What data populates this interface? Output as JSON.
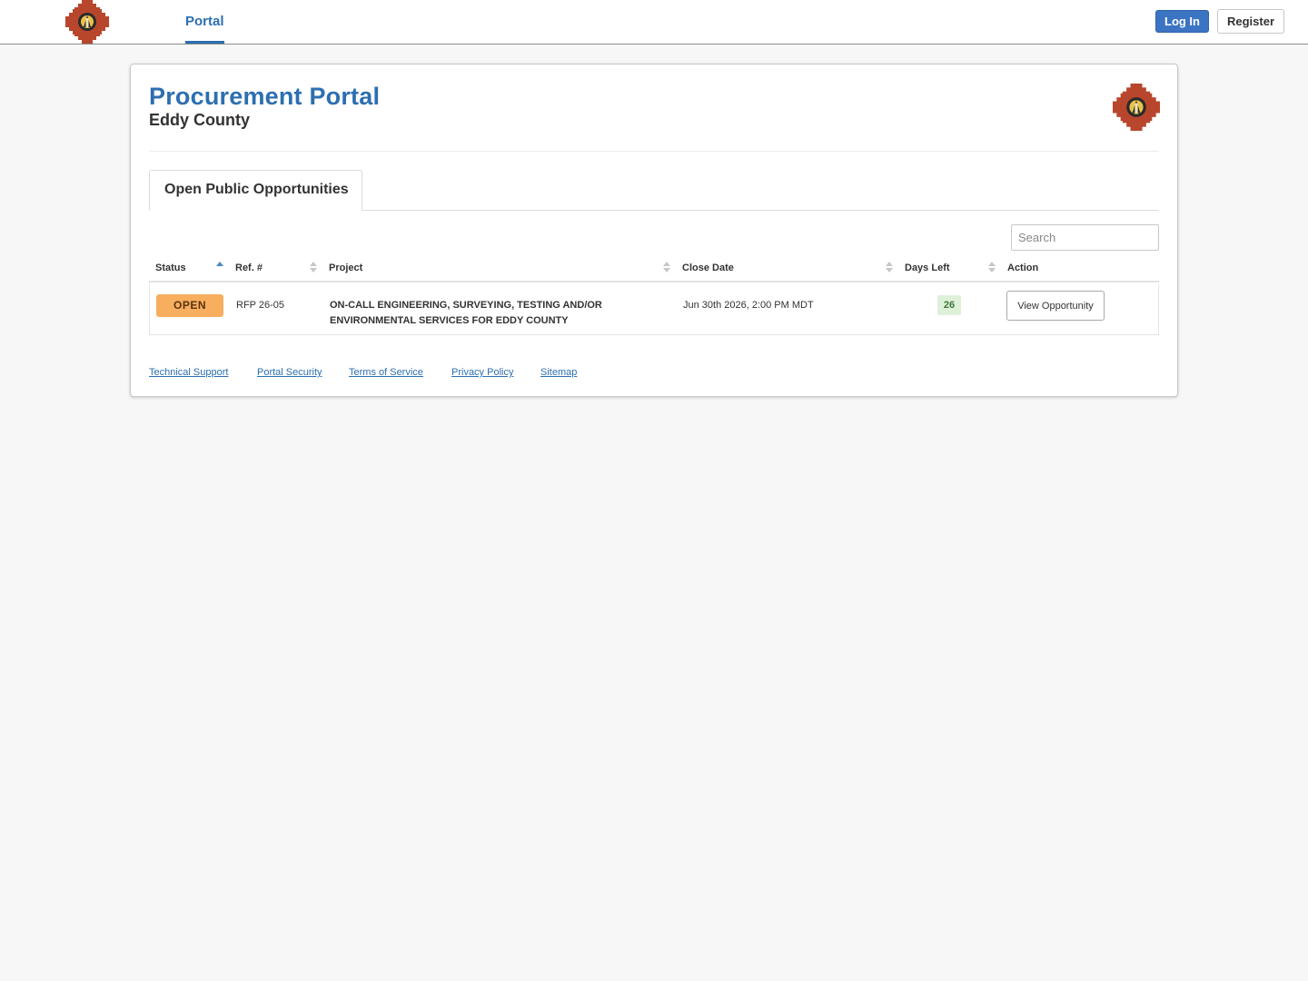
{
  "nav": {
    "logo_icon": "eddy-county-seal-icon",
    "tab_label": "Portal",
    "login_label": "Log In",
    "register_label": "Register"
  },
  "header": {
    "title": "Procurement Portal",
    "subtitle": "Eddy County"
  },
  "tabs": [
    {
      "label": "Open Public Opportunities",
      "active": true
    }
  ],
  "search": {
    "placeholder": "Search",
    "value": ""
  },
  "table": {
    "columns": [
      "Status",
      "Ref. #",
      "Project",
      "Close Date",
      "Days Left",
      "Action"
    ],
    "sort": {
      "column": "Status",
      "direction": "ascending"
    },
    "rows": [
      {
        "status": "OPEN",
        "ref": "RFP 26-05",
        "project_line1": "ON-CALL ENGINEERING, SURVEYING, TESTING AND/OR",
        "project_line2": "ENVIRONMENTAL SERVICES FOR EDDY COUNTY",
        "close_date": "Jun 30th 2026, 2:00 PM MDT",
        "days_left": "26",
        "action": "View Opportunity"
      }
    ]
  },
  "footer": {
    "links": [
      "Technical Support",
      "Portal Security",
      "Terms of Service",
      "Privacy Policy",
      "Sitemap"
    ]
  },
  "colors": {
    "brand_blue": "#2d6fb0",
    "login_button": "#3b74c2",
    "status_open": "#f7ae5f",
    "days_left_bg": "#dff0d8",
    "days_left_text": "#3c763d",
    "page_bg": "#f7f7f7"
  }
}
